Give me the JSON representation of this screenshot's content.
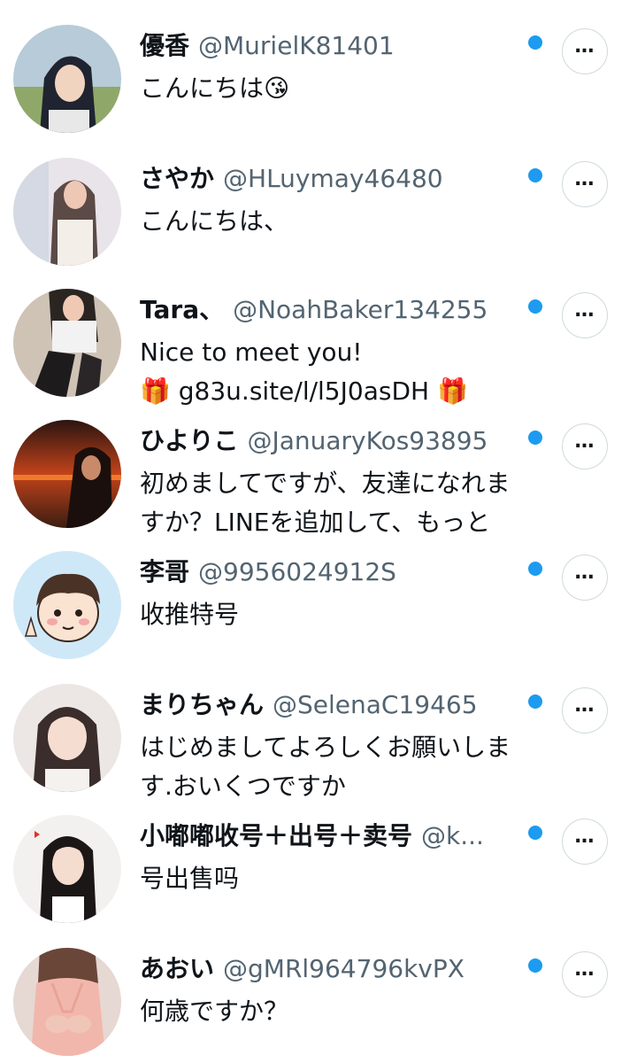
{
  "messages": [
    {
      "name": "優香",
      "handle": "@MurielK81401",
      "lines": [
        "こんにちは😘"
      ],
      "unread": true,
      "avatar": "anime-girl-avatar"
    },
    {
      "name": "さやか",
      "handle": "@HLuymay46480",
      "lines": [
        "こんにちは、"
      ],
      "unread": true,
      "avatar": "woman-photo-avatar"
    },
    {
      "name": "Tara、",
      "handle": "@NoahBaker134255",
      "lines": [
        "Nice to meet you!",
        "🎁 g83u.site/l/l5J0asDH 🎁"
      ],
      "unread": true,
      "avatar": "woman-photo-avatar"
    },
    {
      "name": "ひよりこ",
      "handle": "@JanuaryKos93895",
      "lines": [
        "初めましてですが、友達になれま",
        "すか？LINEを追加して、もっと"
      ],
      "unread": true,
      "avatar": "sunset-woman-avatar"
    },
    {
      "name": "李哥",
      "handle": "@9956024912S",
      "lines": [
        "收推特号"
      ],
      "unread": true,
      "avatar": "cartoon-boy-avatar"
    },
    {
      "name": "まりちゃん",
      "handle": "@SelenaC19465",
      "lines": [
        "はじめましてよろしくお願いしま",
        "す.おいくつですか"
      ],
      "unread": true,
      "avatar": "woman-photo-avatar"
    },
    {
      "name": "小嘟嘟收号＋出号＋卖号",
      "handle": "@k...",
      "lines": [
        "号出售吗"
      ],
      "unread": true,
      "avatar": "woman-photo-avatar"
    },
    {
      "name": "あおい",
      "handle": "@gMRl964796kvPX",
      "lines": [
        "何歳ですか？"
      ],
      "unread": true,
      "avatar": "woman-photo-avatar"
    }
  ],
  "more_button_label": "…",
  "colors": {
    "unread_dot": "#1d9bf0",
    "handle": "#536471",
    "text": "#0f1419",
    "border": "#cfd9de"
  }
}
